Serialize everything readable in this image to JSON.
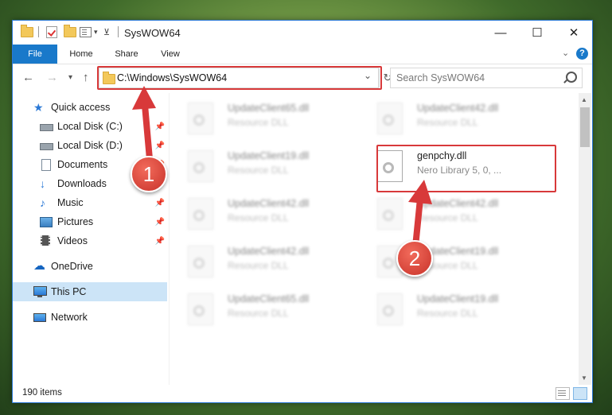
{
  "window": {
    "title": "SysWOW64"
  },
  "ribbon": {
    "tabs": [
      "File",
      "Home",
      "Share",
      "View"
    ]
  },
  "address": {
    "path": "C:\\Windows\\SysWOW64"
  },
  "search": {
    "placeholder": "Search SysWOW64"
  },
  "sidebar": {
    "quick_access": "Quick access",
    "items": [
      "Local Disk (C:)",
      "Local Disk (D:)",
      "Documents",
      "Downloads",
      "Music",
      "Pictures",
      "Videos"
    ],
    "onedrive": "OneDrive",
    "this_pc": "This PC",
    "network": "Network"
  },
  "files": [
    {
      "name": "UpdateClient65.dll",
      "desc": "Resource DLL"
    },
    {
      "name": "UpdateClient42.dll",
      "desc": "Resource DLL"
    },
    {
      "name": "UpdateClient19.dll",
      "desc": "Resource DLL"
    },
    {
      "name": "genpchy.dll",
      "desc": "Nero Library 5, 0, ..."
    },
    {
      "name": "UpdateClient42.dll",
      "desc": "Resource DLL"
    },
    {
      "name": "UpdateClient42.dll",
      "desc": "Resource DLL"
    },
    {
      "name": "UpdateClient42.dll",
      "desc": "Resource DLL"
    },
    {
      "name": "UpdateClient19.dll",
      "desc": "Resource DLL"
    },
    {
      "name": "UpdateClient65.dll",
      "desc": "Resource DLL"
    },
    {
      "name": "UpdateClient19.dll",
      "desc": "Resource DLL"
    }
  ],
  "status": {
    "count": "190 items"
  },
  "callouts": [
    "1",
    "2"
  ],
  "colors": {
    "accent": "#1979ca",
    "highlight": "#d8393a",
    "selected": "#cce4f7"
  }
}
